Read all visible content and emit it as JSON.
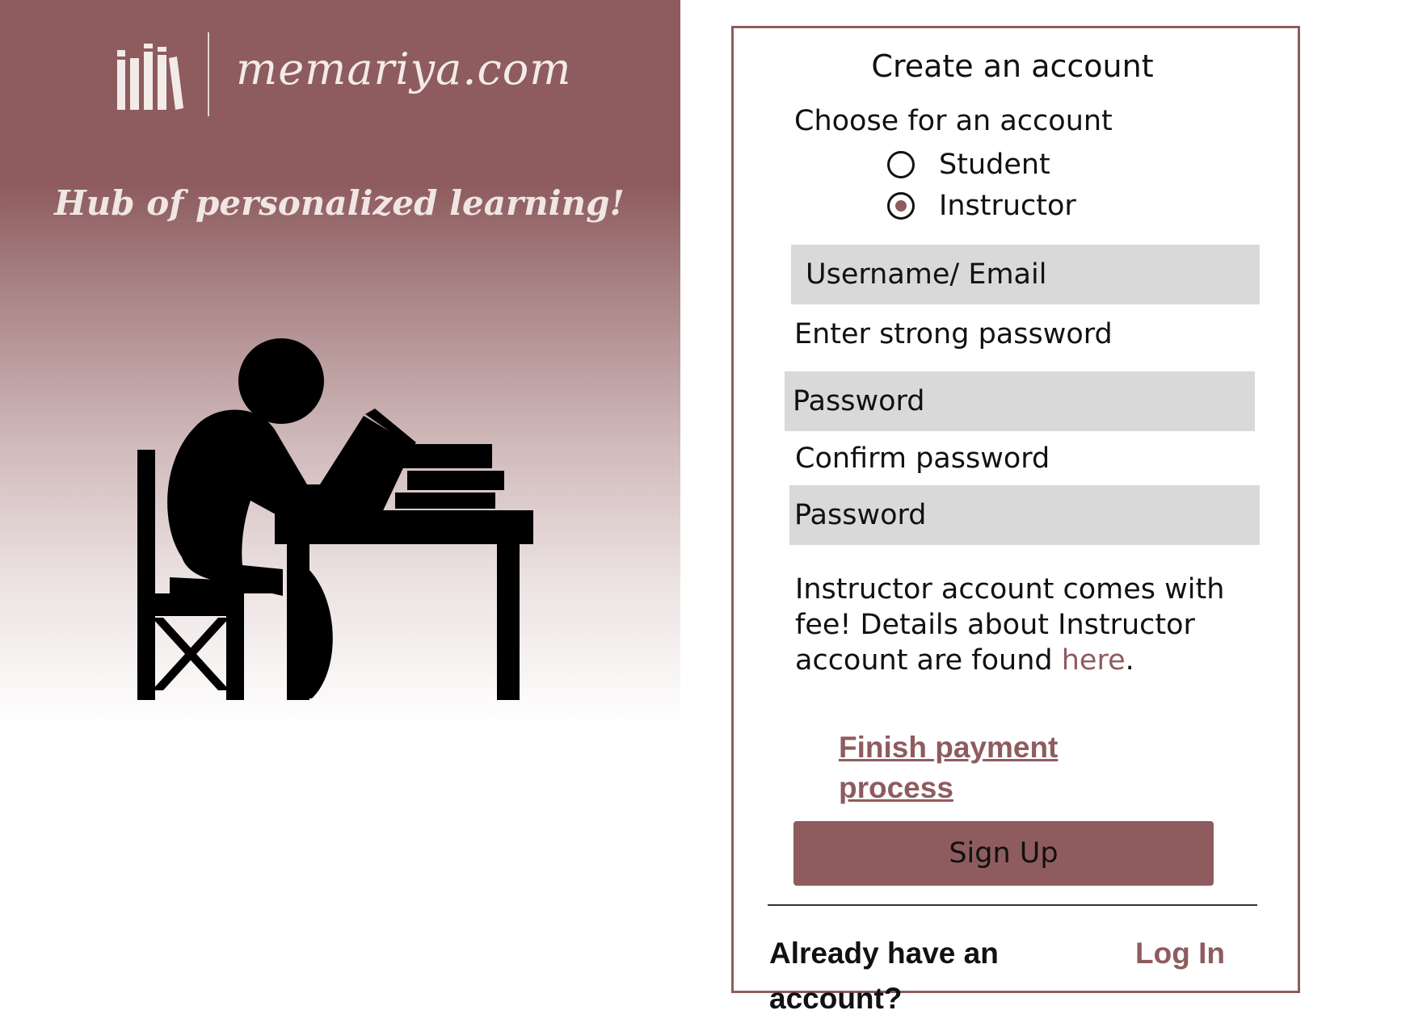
{
  "brand": {
    "site_name": "memariya.com",
    "tagline": "Hub of personalized learning!",
    "logo_icon": "books-icon",
    "illustration_icon": "student-reading-at-desk-icon"
  },
  "form": {
    "title": "Create an account",
    "account_type_label": "Choose for an account",
    "account_types": [
      {
        "label": "Student",
        "selected": false
      },
      {
        "label": "Instructor",
        "selected": true
      }
    ],
    "username_placeholder": "Username/ Email",
    "password_label": "Enter strong password",
    "password_placeholder": "Password",
    "confirm_label": "Confirm password",
    "confirm_placeholder": "Password",
    "instructor_note_text": "Instructor account comes with fee! Details about Instructor account are found ",
    "instructor_note_link": "here",
    "instructor_note_end": ".",
    "payment_link": "Finish payment process",
    "submit_label": "Sign Up",
    "login_prompt": "Already have an account?",
    "login_link": "Log In"
  },
  "colors": {
    "accent": "#8e5c5e",
    "field_background": "#d9d9d9",
    "text": "#111111"
  }
}
